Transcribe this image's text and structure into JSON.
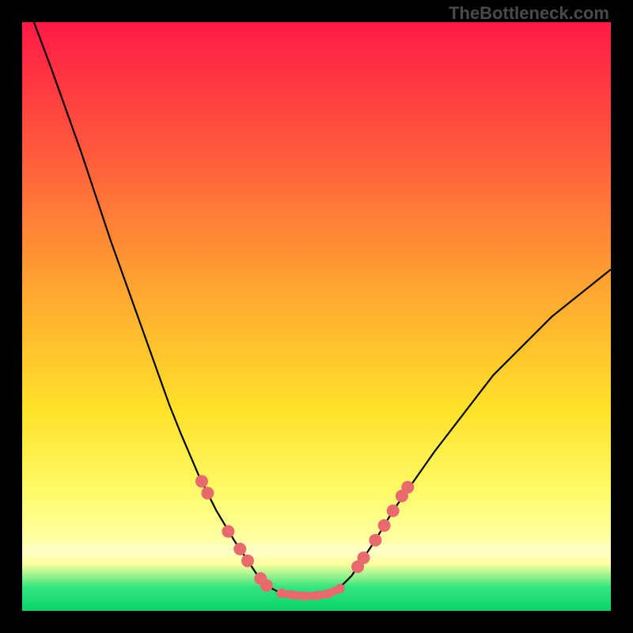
{
  "watermark": "TheBottleneck.com",
  "chart_data": {
    "type": "line",
    "title": "",
    "xlabel": "",
    "ylabel": "",
    "xlim": [
      0,
      100
    ],
    "ylim": [
      0,
      100
    ],
    "series": [
      {
        "name": "bottleneck-curve",
        "x": [
          2,
          5,
          10,
          15,
          20,
          25,
          27,
          30,
          33,
          36,
          38,
          40,
          42,
          44,
          48,
          52,
          54,
          56,
          58,
          60,
          63,
          70,
          80,
          90,
          100
        ],
        "y": [
          100,
          92,
          78,
          63,
          49,
          35,
          30,
          23,
          17,
          12,
          9,
          6,
          4,
          3,
          2.5,
          3,
          4,
          6,
          9,
          12,
          17,
          27,
          40,
          50,
          58
        ]
      }
    ],
    "markers": [
      {
        "name": "left-marker-1",
        "x": 30.5,
        "y": 22
      },
      {
        "name": "left-marker-2",
        "x": 31.5,
        "y": 20
      },
      {
        "name": "left-marker-3",
        "x": 35.0,
        "y": 13.5
      },
      {
        "name": "left-marker-4",
        "x": 37.0,
        "y": 10.5
      },
      {
        "name": "left-marker-5",
        "x": 38.3,
        "y": 8.5
      },
      {
        "name": "left-marker-6",
        "x": 40.5,
        "y": 5.5
      },
      {
        "name": "left-marker-7",
        "x": 41.5,
        "y": 4.3
      },
      {
        "name": "flat-marker-1",
        "x": 44.0,
        "y": 3.0
      },
      {
        "name": "flat-marker-2",
        "x": 46.0,
        "y": 2.7
      },
      {
        "name": "flat-marker-3",
        "x": 48.0,
        "y": 2.5
      },
      {
        "name": "flat-marker-4",
        "x": 50.0,
        "y": 2.6
      },
      {
        "name": "flat-marker-5",
        "x": 52.0,
        "y": 2.9
      },
      {
        "name": "flat-marker-6",
        "x": 54.0,
        "y": 3.8
      },
      {
        "name": "right-marker-1",
        "x": 57.0,
        "y": 7.5
      },
      {
        "name": "right-marker-2",
        "x": 58.0,
        "y": 9.0
      },
      {
        "name": "right-marker-3",
        "x": 60.0,
        "y": 12.0
      },
      {
        "name": "right-marker-4",
        "x": 61.5,
        "y": 14.5
      },
      {
        "name": "right-marker-5",
        "x": 63.0,
        "y": 17.0
      },
      {
        "name": "right-marker-6",
        "x": 64.5,
        "y": 19.5
      },
      {
        "name": "right-marker-7",
        "x": 65.5,
        "y": 21.0
      }
    ],
    "colors": {
      "curve": "#000000",
      "marker": "#e86a6d",
      "flat_segment": "#e86a6d"
    }
  }
}
